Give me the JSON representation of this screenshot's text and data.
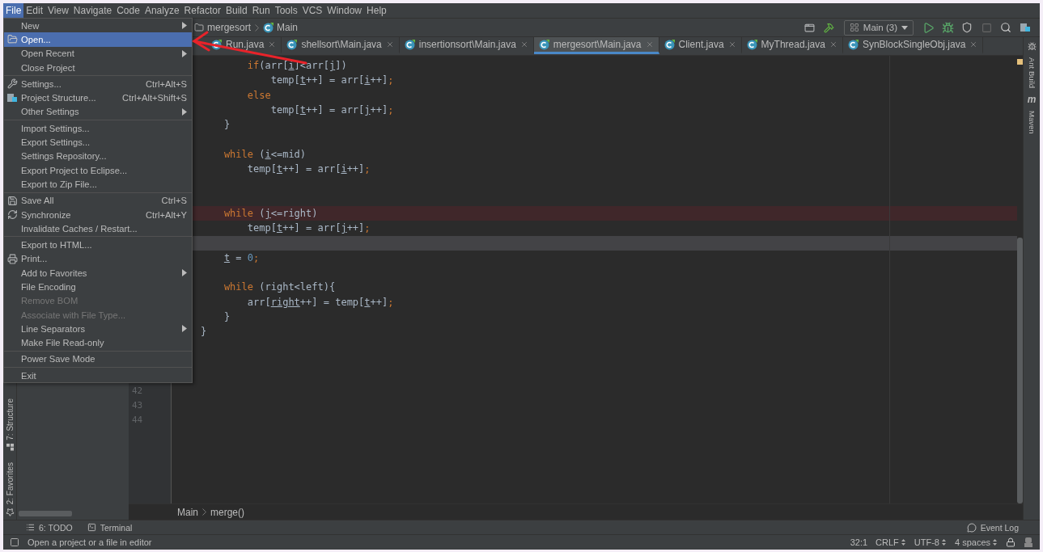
{
  "menubar": [
    {
      "label": "File",
      "selected": true
    },
    {
      "label": "Edit",
      "selected": false
    },
    {
      "label": "View",
      "selected": false
    },
    {
      "label": "Navigate",
      "selected": false
    },
    {
      "label": "Code",
      "selected": false
    },
    {
      "label": "Analyze",
      "selected": false
    },
    {
      "label": "Refactor",
      "selected": false
    },
    {
      "label": "Build",
      "selected": false
    },
    {
      "label": "Run",
      "selected": false
    },
    {
      "label": "Tools",
      "selected": false
    },
    {
      "label": "VCS",
      "selected": false
    },
    {
      "label": "Window",
      "selected": false
    },
    {
      "label": "Help",
      "selected": false
    }
  ],
  "file_menu": {
    "items": [
      {
        "kind": "item",
        "label": "New",
        "selected": false,
        "disabled": false,
        "submenu": true
      },
      {
        "kind": "item",
        "label": "Open...",
        "selected": true,
        "disabled": false,
        "submenu": false
      },
      {
        "kind": "item",
        "label": "Open Recent",
        "selected": false,
        "disabled": false,
        "submenu": true
      },
      {
        "kind": "item",
        "label": "Close Project",
        "selected": false,
        "disabled": false,
        "submenu": false
      },
      {
        "kind": "separator"
      },
      {
        "kind": "item",
        "label": "Settings...",
        "shortcut": "Ctrl+Alt+S",
        "selected": false,
        "disabled": false,
        "submenu": false
      },
      {
        "kind": "item",
        "label": "Project Structure...",
        "shortcut": "Ctrl+Alt+Shift+S",
        "selected": false,
        "disabled": false,
        "submenu": false
      },
      {
        "kind": "item",
        "label": "Other Settings",
        "selected": false,
        "disabled": false,
        "submenu": true
      },
      {
        "kind": "separator"
      },
      {
        "kind": "item",
        "label": "Import Settings...",
        "selected": false,
        "disabled": false,
        "submenu": false
      },
      {
        "kind": "item",
        "label": "Export Settings...",
        "selected": false,
        "disabled": false,
        "submenu": false
      },
      {
        "kind": "item",
        "label": "Settings Repository...",
        "selected": false,
        "disabled": false,
        "submenu": false
      },
      {
        "kind": "item",
        "label": "Export Project to Eclipse...",
        "selected": false,
        "disabled": false,
        "submenu": false
      },
      {
        "kind": "item",
        "label": "Export to Zip File...",
        "selected": false,
        "disabled": false,
        "submenu": false
      },
      {
        "kind": "separator"
      },
      {
        "kind": "item",
        "label": "Save All",
        "shortcut": "Ctrl+S",
        "selected": false,
        "disabled": false,
        "submenu": false
      },
      {
        "kind": "item",
        "label": "Synchronize",
        "shortcut": "Ctrl+Alt+Y",
        "selected": false,
        "disabled": false,
        "submenu": false
      },
      {
        "kind": "item",
        "label": "Invalidate Caches / Restart...",
        "selected": false,
        "disabled": false,
        "submenu": false
      },
      {
        "kind": "separator"
      },
      {
        "kind": "item",
        "label": "Export to HTML...",
        "selected": false,
        "disabled": false,
        "submenu": false
      },
      {
        "kind": "item",
        "label": "Print...",
        "selected": false,
        "disabled": false,
        "submenu": false
      },
      {
        "kind": "item",
        "label": "Add to Favorites",
        "selected": false,
        "disabled": false,
        "submenu": true
      },
      {
        "kind": "item",
        "label": "File Encoding",
        "selected": false,
        "disabled": false,
        "submenu": false
      },
      {
        "kind": "item",
        "label": "Remove BOM",
        "selected": false,
        "disabled": true,
        "submenu": false
      },
      {
        "kind": "item",
        "label": "Associate with File Type...",
        "selected": false,
        "disabled": true,
        "submenu": false
      },
      {
        "kind": "item",
        "label": "Line Separators",
        "selected": false,
        "disabled": false,
        "submenu": true
      },
      {
        "kind": "item",
        "label": "Make File Read-only",
        "selected": false,
        "disabled": false,
        "submenu": false
      },
      {
        "kind": "separator"
      },
      {
        "kind": "item",
        "label": "Power Save Mode",
        "selected": false,
        "disabled": false,
        "submenu": false
      },
      {
        "kind": "separator"
      },
      {
        "kind": "item",
        "label": "Exit",
        "selected": false,
        "disabled": false,
        "submenu": false
      }
    ]
  },
  "navbar": {
    "breadcrumb": [
      "mergesort",
      "Main"
    ],
    "run_config": "Main (3)"
  },
  "tabs": [
    {
      "label": "Run.java",
      "selected": false
    },
    {
      "label": "shellsort\\Main.java",
      "selected": false
    },
    {
      "label": "insertionsort\\Main.java",
      "selected": false
    },
    {
      "label": "mergesort\\Main.java",
      "selected": true
    },
    {
      "label": "Client.java",
      "selected": false
    },
    {
      "label": "MyThread.java",
      "selected": false
    },
    {
      "label": "SynBlockSingleObj.java",
      "selected": false
    }
  ],
  "editor": {
    "lines": [
      {
        "highlighted": false,
        "current": false,
        "segments": [
          {
            "kind": "keyword",
            "text": "        if"
          },
          {
            "kind": "plain",
            "text": "(arr["
          },
          {
            "kind": "variable",
            "text": "i"
          },
          {
            "kind": "plain",
            "text": "]<arr["
          },
          {
            "kind": "variable",
            "text": "j"
          },
          {
            "kind": "plain",
            "text": "])"
          }
        ]
      },
      {
        "highlighted": false,
        "current": false,
        "segments": [
          {
            "kind": "plain",
            "text": "            temp["
          },
          {
            "kind": "variable",
            "text": "t"
          },
          {
            "kind": "plain",
            "text": "++] = arr["
          },
          {
            "kind": "variable",
            "text": "i"
          },
          {
            "kind": "plain",
            "text": "++]"
          },
          {
            "kind": "keyword",
            "text": ";"
          }
        ]
      },
      {
        "highlighted": false,
        "current": false,
        "segments": [
          {
            "kind": "keyword",
            "text": "        else"
          }
        ]
      },
      {
        "highlighted": false,
        "current": false,
        "segments": [
          {
            "kind": "plain",
            "text": "            temp["
          },
          {
            "kind": "variable",
            "text": "t"
          },
          {
            "kind": "plain",
            "text": "++] = arr["
          },
          {
            "kind": "variable",
            "text": "j"
          },
          {
            "kind": "plain",
            "text": "++]"
          },
          {
            "kind": "keyword",
            "text": ";"
          }
        ]
      },
      {
        "highlighted": false,
        "current": false,
        "segments": [
          {
            "kind": "plain",
            "text": "    }"
          }
        ]
      },
      {
        "highlighted": false,
        "current": false
      },
      {
        "highlighted": false,
        "current": false,
        "segments": [
          {
            "kind": "keyword",
            "text": "    while"
          },
          {
            "kind": "plain",
            "text": " ("
          },
          {
            "kind": "variable",
            "text": "i"
          },
          {
            "kind": "plain",
            "text": "<=mid)"
          }
        ]
      },
      {
        "highlighted": false,
        "current": false,
        "segments": [
          {
            "kind": "plain",
            "text": "        temp["
          },
          {
            "kind": "variable",
            "text": "t"
          },
          {
            "kind": "plain",
            "text": "++] = arr["
          },
          {
            "kind": "variable",
            "text": "i"
          },
          {
            "kind": "plain",
            "text": "++]"
          },
          {
            "kind": "keyword",
            "text": ";"
          }
        ]
      },
      {
        "highlighted": false,
        "current": false
      },
      {
        "highlighted": false,
        "current": false
      },
      {
        "highlighted": true,
        "current": false,
        "segments": [
          {
            "kind": "keyword",
            "text": "    while"
          },
          {
            "kind": "plain",
            "text": " ("
          },
          {
            "kind": "variable",
            "text": "j"
          },
          {
            "kind": "plain",
            "text": "<=right)"
          }
        ]
      },
      {
        "highlighted": false,
        "current": false,
        "segments": [
          {
            "kind": "plain",
            "text": "        temp["
          },
          {
            "kind": "variable",
            "text": "t"
          },
          {
            "kind": "plain",
            "text": "++] = arr["
          },
          {
            "kind": "variable",
            "text": "j"
          },
          {
            "kind": "plain",
            "text": "++]"
          },
          {
            "kind": "keyword",
            "text": ";"
          }
        ]
      },
      {
        "highlighted": false,
        "current": true
      },
      {
        "highlighted": false,
        "current": false,
        "segments": [
          {
            "kind": "variable",
            "text": "    t"
          },
          {
            "kind": "plain",
            "text": " = "
          },
          {
            "kind": "number",
            "text": "0"
          },
          {
            "kind": "keyword",
            "text": ";"
          }
        ]
      },
      {
        "highlighted": false,
        "current": false
      },
      {
        "highlighted": false,
        "current": false,
        "segments": [
          {
            "kind": "keyword",
            "text": "    while"
          },
          {
            "kind": "plain",
            "text": " (right<left){"
          }
        ]
      },
      {
        "highlighted": false,
        "current": false,
        "segments": [
          {
            "kind": "plain",
            "text": "        arr["
          },
          {
            "kind": "variable",
            "text": "right"
          },
          {
            "kind": "plain",
            "text": "++] = temp["
          },
          {
            "kind": "variable",
            "text": "t"
          },
          {
            "kind": "plain",
            "text": "++]"
          },
          {
            "kind": "keyword",
            "text": ";"
          }
        ]
      },
      {
        "highlighted": false,
        "current": false,
        "segments": [
          {
            "kind": "plain",
            "text": "    }"
          }
        ]
      },
      {
        "highlighted": false,
        "current": false,
        "segments": [
          {
            "kind": "plain",
            "text": "}"
          }
        ]
      },
      {
        "highlighted": false,
        "current": false
      },
      {
        "highlighted": false,
        "current": false
      },
      {
        "highlighted": false,
        "current": false
      },
      {
        "highlighted": false,
        "current": false,
        "number": "42"
      },
      {
        "highlighted": false,
        "current": false,
        "number": "43"
      },
      {
        "highlighted": false,
        "current": false,
        "number": "44"
      }
    ],
    "breadcrumb": [
      "Main",
      "merge()"
    ]
  },
  "left_strip": [
    "7: Structure",
    "2: Favorites"
  ],
  "right_strip": [
    {
      "label": "Ant Build"
    },
    {
      "glyph": "m",
      "label": "Maven"
    }
  ],
  "tool_bar": {
    "left": [
      "6: TODO",
      "Terminal"
    ],
    "right": "Event Log"
  },
  "status_bar": {
    "message": "Open a project or a file in editor",
    "position": "32:1",
    "line_separator": "CRLF",
    "encoding": "UTF-8",
    "indent": "4 spaces"
  }
}
